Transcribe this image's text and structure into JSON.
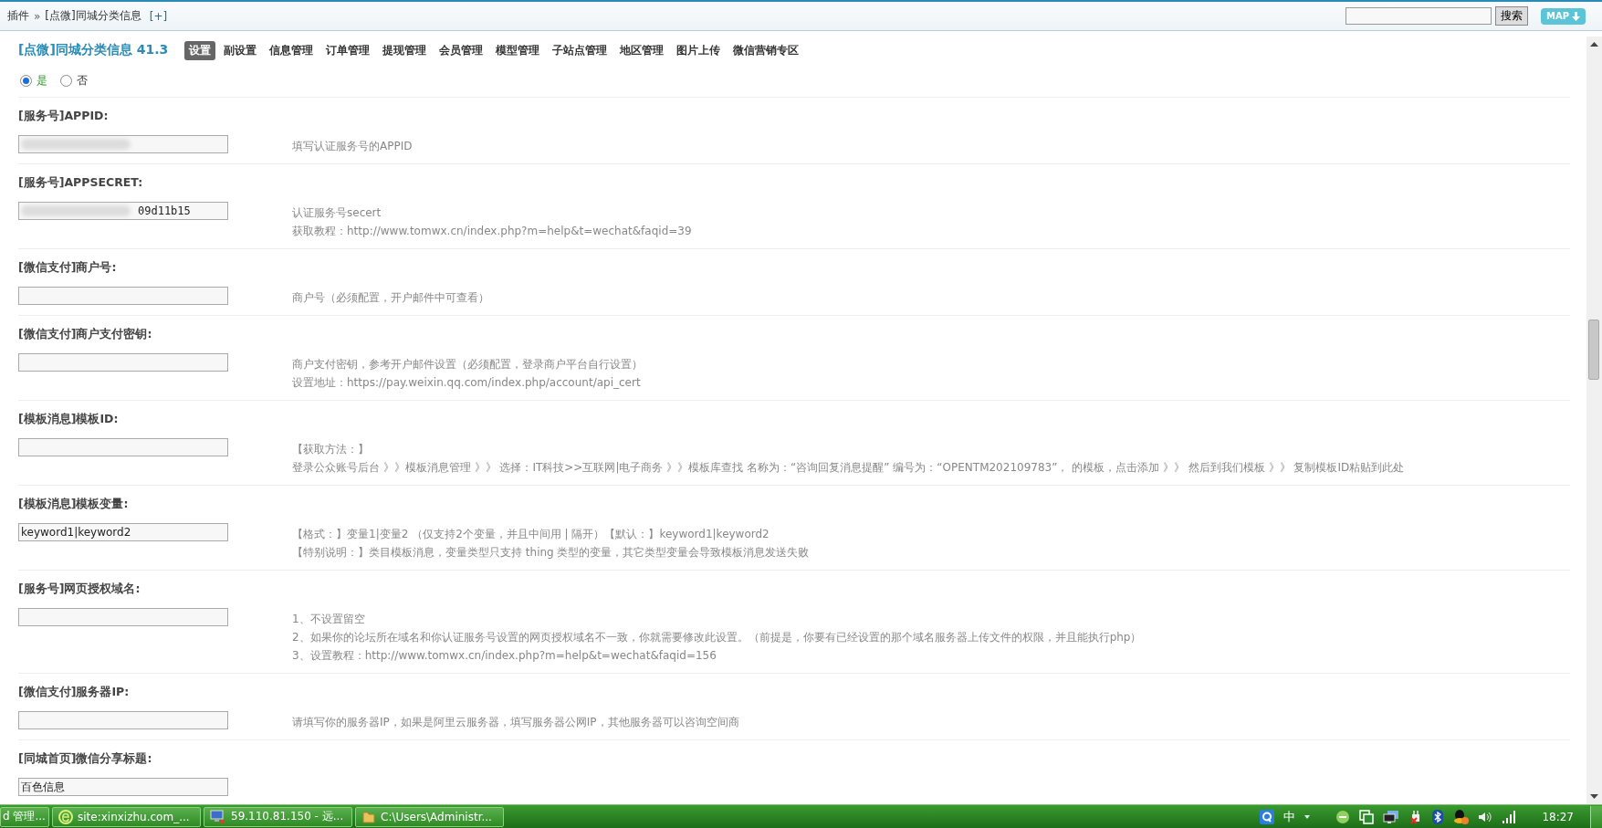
{
  "breadcrumb": {
    "items": [
      "插件",
      "[点微]同城分类信息"
    ],
    "separator": "»",
    "add_label": "[+]"
  },
  "search": {
    "button": "搜索"
  },
  "map_button": {
    "label": "MAP"
  },
  "plugin_title": "[点微]同城分类信息 41.3",
  "tabs": [
    {
      "label": "设置",
      "selected": true
    },
    {
      "label": "副设置",
      "selected": false
    },
    {
      "label": "信息管理",
      "selected": false
    },
    {
      "label": "订单管理",
      "selected": false
    },
    {
      "label": "提现管理",
      "selected": false
    },
    {
      "label": "会员管理",
      "selected": false
    },
    {
      "label": "模型管理",
      "selected": false
    },
    {
      "label": "子站点管理",
      "selected": false
    },
    {
      "label": "地区管理",
      "selected": false
    },
    {
      "label": "图片上传",
      "selected": false
    },
    {
      "label": "微信营销专区",
      "selected": false
    }
  ],
  "radio_options": [
    {
      "label": "是",
      "selected": true
    },
    {
      "label": "否",
      "selected": false
    }
  ],
  "settings": [
    {
      "label": "[服务号]APPID:",
      "redacted": true,
      "help": [
        "填写认证服务号的APPID"
      ]
    },
    {
      "label": "[服务号]APPSECRET:",
      "value": "09d11b15",
      "redacted": true,
      "help": [
        "认证服务号secert",
        "获取教程：http://www.tomwx.cn/index.php?m=help&t=wechat&faqid=39"
      ]
    },
    {
      "label": "[微信支付]商户号:",
      "redacted": false,
      "help": [
        "商户号（必须配置，开户邮件中可查看）"
      ]
    },
    {
      "label": "[微信支付]商户支付密钥:",
      "redacted": false,
      "help": [
        "商户支付密钥，参考开户邮件设置（必须配置，登录商户平台自行设置）",
        "设置地址：https://pay.weixin.qq.com/index.php/account/api_cert"
      ]
    },
    {
      "label": "[模板消息]模板ID:",
      "redacted": false,
      "help": [
        "【获取方法：】",
        "登录公众账号后台 》》模板消息管理 》》 选择：IT科技>>互联网|电子商务 》》模板库查找 名称为：“咨询回复消息提醒” 编号为：“OPENTM202109783”， 的模板，点击添加 》》 然后到我们模板 》》 复制模板ID粘贴到此处"
      ]
    },
    {
      "label": "[模板消息]模板变量:",
      "value": "keyword1|keyword2",
      "redacted": false,
      "help": [
        "【格式：】变量1|变量2 （仅支持2个变量，并且中间用 | 隔开）【默认：】keyword1|keyword2",
        "【特别说明：】类目模板消息，变量类型只支持 thing 类型的变量，其它类型变量会导致模板消息发送失败"
      ]
    },
    {
      "label": "[服务号]网页授权域名:",
      "redacted": false,
      "help": [
        "1、不设置留空",
        "2、如果你的论坛所在域名和你认证服务号设置的网页授权域名不一致，你就需要修改此设置。（前提是，你要有已经设置的那个域名服务器上传文件的权限，并且能执行php）",
        "3、设置教程：http://www.tomwx.cn/index.php?m=help&t=wechat&faqid=156"
      ]
    },
    {
      "label": "[微信支付]服务器IP:",
      "redacted": false,
      "help": [
        "请填写你的服务器IP，如果是阿里云服务器，填写服务器公网IP，其他服务器可以咨询空间商"
      ]
    },
    {
      "label": "[同城首页]微信分享标题:",
      "value": "百色信息",
      "redacted": false
    }
  ],
  "taskbar": {
    "windows": [
      {
        "kind": "plain",
        "label": "d 管理..."
      },
      {
        "kind": "browser",
        "label": "site:xinxizhu.com_..."
      },
      {
        "kind": "remote",
        "label": "59.110.81.150 - 远..."
      },
      {
        "kind": "folder",
        "label": "C:\\Users\\Administr..."
      }
    ],
    "input_method": "中",
    "clock": "18:27"
  }
}
